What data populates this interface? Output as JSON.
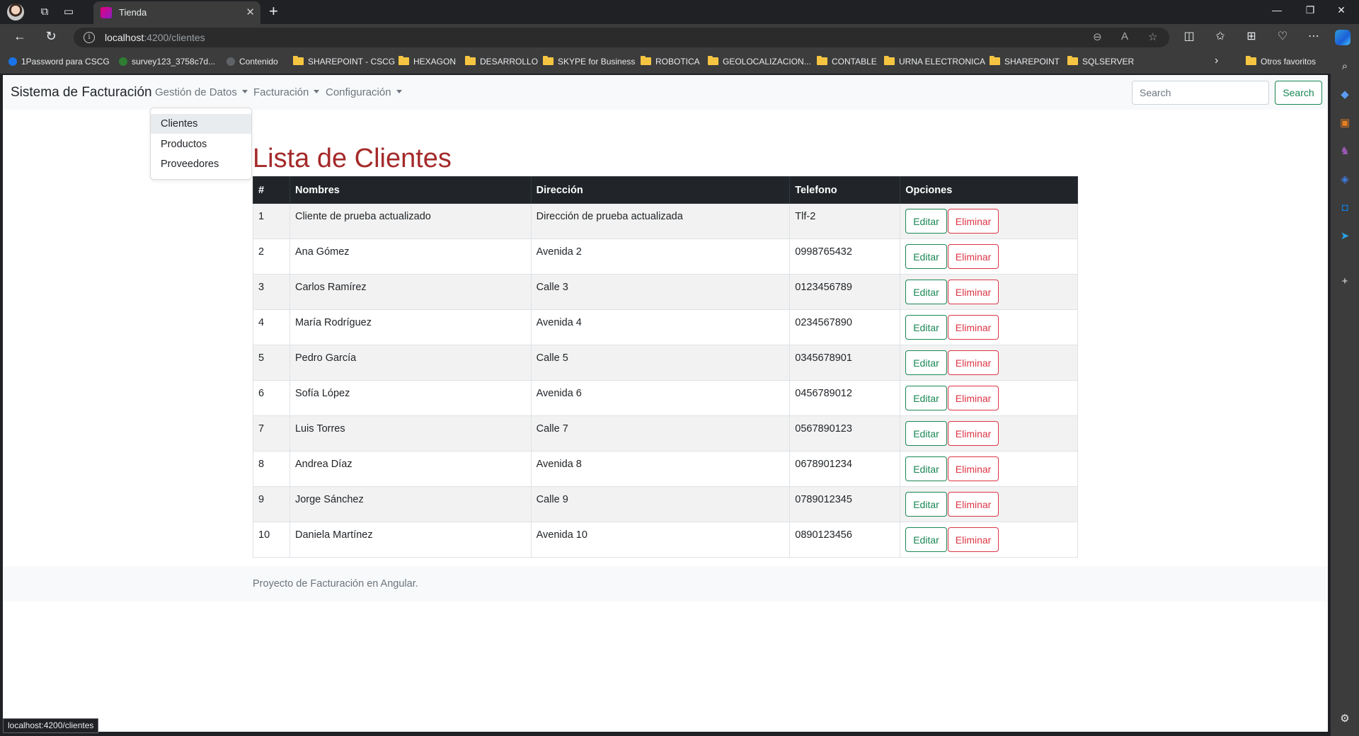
{
  "browser": {
    "tab_title": "Tienda",
    "url_host": "localhost",
    "url_path": ":4200/clientes",
    "status_url": "localhost:4200/clientes"
  },
  "favorites": [
    {
      "label": "1Password para CSCG",
      "kind": "site",
      "color": "#1a73e8"
    },
    {
      "label": "survey123_3758c7d...",
      "kind": "site",
      "color": "#2e7d32"
    },
    {
      "label": "Contenido",
      "kind": "site",
      "color": "#5f6368"
    },
    {
      "label": "SHAREPOINT - CSCG",
      "kind": "folder"
    },
    {
      "label": "HEXAGON",
      "kind": "folder"
    },
    {
      "label": "DESARROLLO",
      "kind": "folder"
    },
    {
      "label": "SKYPE for Business",
      "kind": "folder"
    },
    {
      "label": "ROBOTICA",
      "kind": "folder"
    },
    {
      "label": "GEOLOCALIZACION...",
      "kind": "folder"
    },
    {
      "label": "CONTABLE",
      "kind": "folder"
    },
    {
      "label": "URNA ELECTRONICA",
      "kind": "folder"
    },
    {
      "label": "SHAREPOINT",
      "kind": "folder"
    },
    {
      "label": "SQLSERVER",
      "kind": "folder"
    }
  ],
  "other_favorites": "Otros favoritos",
  "app": {
    "brand": "Sistema de Facturación",
    "nav": [
      "Gestión de Datos",
      "Facturación",
      "Configuración"
    ],
    "search_placeholder": "Search",
    "search_button": "Search",
    "dropdown_items": [
      "Clientes",
      "Productos",
      "Proveedores"
    ]
  },
  "page_title": "Lista de Clientes",
  "table": {
    "headers": [
      "#",
      "Nombres",
      "Dirección",
      "Telefono",
      "Opciones"
    ],
    "rows": [
      {
        "id": "1",
        "nombre": "Cliente de prueba actualizado",
        "direccion": "Dirección de prueba actualizada",
        "telefono": "Tlf-2"
      },
      {
        "id": "2",
        "nombre": "Ana Gómez",
        "direccion": "Avenida 2",
        "telefono": "0998765432"
      },
      {
        "id": "3",
        "nombre": "Carlos Ramírez",
        "direccion": "Calle 3",
        "telefono": "0123456789"
      },
      {
        "id": "4",
        "nombre": "María Rodríguez",
        "direccion": "Avenida 4",
        "telefono": "0234567890"
      },
      {
        "id": "5",
        "nombre": "Pedro García",
        "direccion": "Calle 5",
        "telefono": "0345678901"
      },
      {
        "id": "6",
        "nombre": "Sofía López",
        "direccion": "Avenida 6",
        "telefono": "0456789012"
      },
      {
        "id": "7",
        "nombre": "Luis Torres",
        "direccion": "Calle 7",
        "telefono": "0567890123"
      },
      {
        "id": "8",
        "nombre": "Andrea Díaz",
        "direccion": "Avenida 8",
        "telefono": "0678901234"
      },
      {
        "id": "9",
        "nombre": "Jorge Sánchez",
        "direccion": "Calle 9",
        "telefono": "0789012345"
      },
      {
        "id": "10",
        "nombre": "Daniela Martínez",
        "direccion": "Avenida 10",
        "telefono": "0890123456"
      }
    ],
    "edit_label": "Editar",
    "delete_label": "Eliminar"
  },
  "footer": "Proyecto de Facturación en Angular.",
  "colors": {
    "title": "#a52a2a",
    "edit": "#198754",
    "delete": "#dc3545",
    "table_header": "#212529"
  }
}
